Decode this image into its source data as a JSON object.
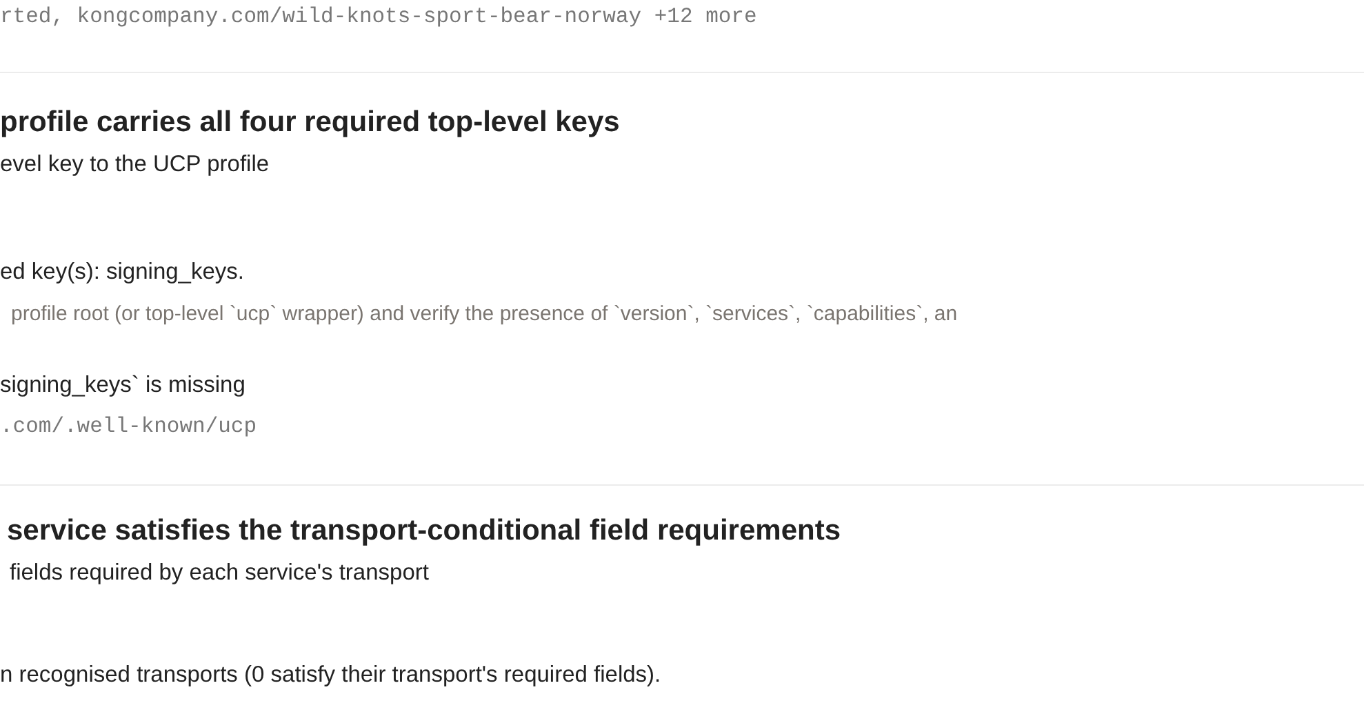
{
  "sources_line": "rted, kongcompany.com/wild-knots-sport-bear-norway +12 more",
  "checks": [
    {
      "title": "profile carries all four required top-level keys",
      "description": "evel key to the UCP profile",
      "result": "ed key(s): signing_keys.",
      "method": "profile root (or top-level `ucp` wrapper) and verify the presence of `version`, `services`, `capabilities`, an",
      "finding": "signing_keys` is missing",
      "location": ".com/.well-known/ucp"
    },
    {
      "title": "service satisfies the transport-conditional field requirements",
      "description": "fields required by each service's transport",
      "result": "n recognised transports (0 satisfy their transport's required fields)."
    }
  ]
}
